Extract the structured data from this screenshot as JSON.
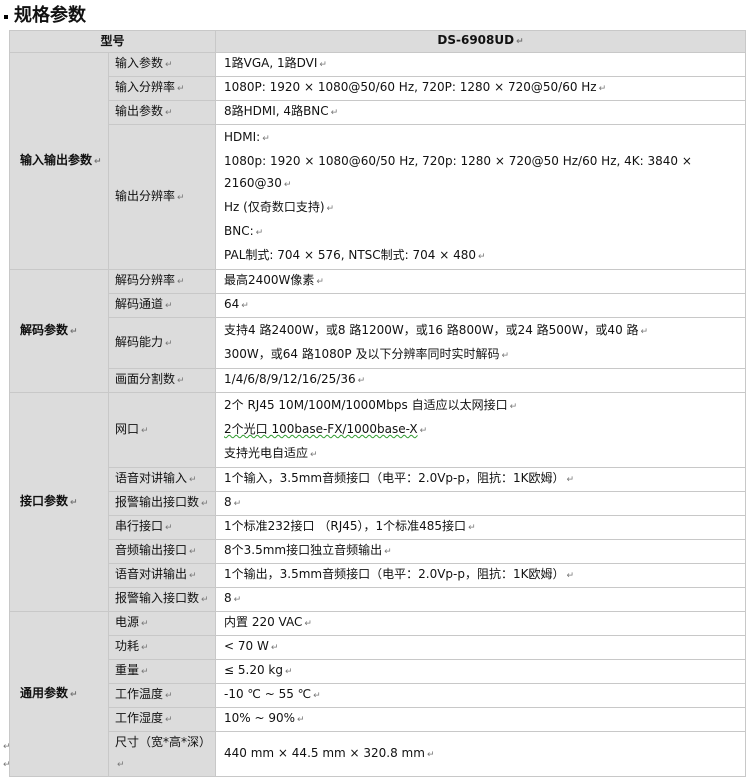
{
  "heading": "规格参数",
  "para_mark": "↵",
  "cell_mark": "↵",
  "header": {
    "label": "型号",
    "model": "DS-6908UD"
  },
  "sections": [
    {
      "name": "输入输出参数",
      "rows": [
        {
          "label": "输入参数",
          "lines": [
            "1路VGA, 1路DVI"
          ]
        },
        {
          "label": "输入分辨率",
          "lines": [
            "1080P: 1920 × 1080@50/60 Hz, 720P: 1280 × 720@50/60 Hz"
          ]
        },
        {
          "label": "输出参数",
          "lines": [
            "8路HDMI, 4路BNC"
          ]
        },
        {
          "label": "输出分辨率",
          "lines": [
            "HDMI:",
            "1080p: 1920 × 1080@60/50 Hz, 720p: 1280 × 720@50 Hz/60 Hz, 4K: 3840 × 2160@30",
            "Hz (仅奇数口支持)",
            "BNC:",
            "PAL制式: 704 × 576, NTSC制式: 704 × 480"
          ]
        }
      ]
    },
    {
      "name": "解码参数",
      "rows": [
        {
          "label": "解码分辨率",
          "lines": [
            "最高2400W像素"
          ]
        },
        {
          "label": "解码通道",
          "lines": [
            "64"
          ]
        },
        {
          "label": "解码能力",
          "lines": [
            "支持4 路2400W，或8 路1200W，或16 路800W，或24 路500W，或40 路",
            "300W，或64 路1080P 及以下分辨率同时实时解码"
          ]
        },
        {
          "label": "画面分割数",
          "lines": [
            "1/4/6/8/9/12/16/25/36"
          ]
        }
      ]
    },
    {
      "name": "接口参数",
      "rows": [
        {
          "label": "网口",
          "lines": [
            "2个 RJ45 10M/100M/1000Mbps 自适应以太网接口",
            "2个光口 100base-FX/1000base-X",
            "支持光电自适应"
          ]
        },
        {
          "label": "语音对讲输入",
          "lines": [
            "1个输入，3.5mm音频接口（电平：2.0Vp-p，阻抗：1K欧姆）"
          ]
        },
        {
          "label": "报警输出接口数",
          "lines": [
            "8"
          ]
        },
        {
          "label": "串行接口",
          "lines": [
            "1个标准232接口 （RJ45），1个标准485接口"
          ]
        },
        {
          "label": "音频输出接口",
          "lines": [
            "8个3.5mm接口独立音频输出"
          ]
        },
        {
          "label": "语音对讲输出",
          "lines": [
            "1个输出，3.5mm音频接口（电平：2.0Vp-p，阻抗：1K欧姆）"
          ]
        },
        {
          "label": "报警输入接口数",
          "lines": [
            "8"
          ]
        }
      ]
    },
    {
      "name": "通用参数",
      "rows": [
        {
          "label": "电源",
          "lines": [
            "内置 220 VAC"
          ]
        },
        {
          "label": "功耗",
          "lines": [
            "< 70 W"
          ]
        },
        {
          "label": "重量",
          "lines": [
            "≤ 5.20 kg"
          ]
        },
        {
          "label": "工作温度",
          "lines": [
            "-10 ℃ ~ 55 ℃"
          ]
        },
        {
          "label": "工作湿度",
          "lines": [
            "10% ~ 90%"
          ]
        },
        {
          "label": "尺寸（宽*高*深）",
          "lines": [
            "440 mm × 44.5 mm × 320.8 mm"
          ]
        }
      ]
    }
  ]
}
